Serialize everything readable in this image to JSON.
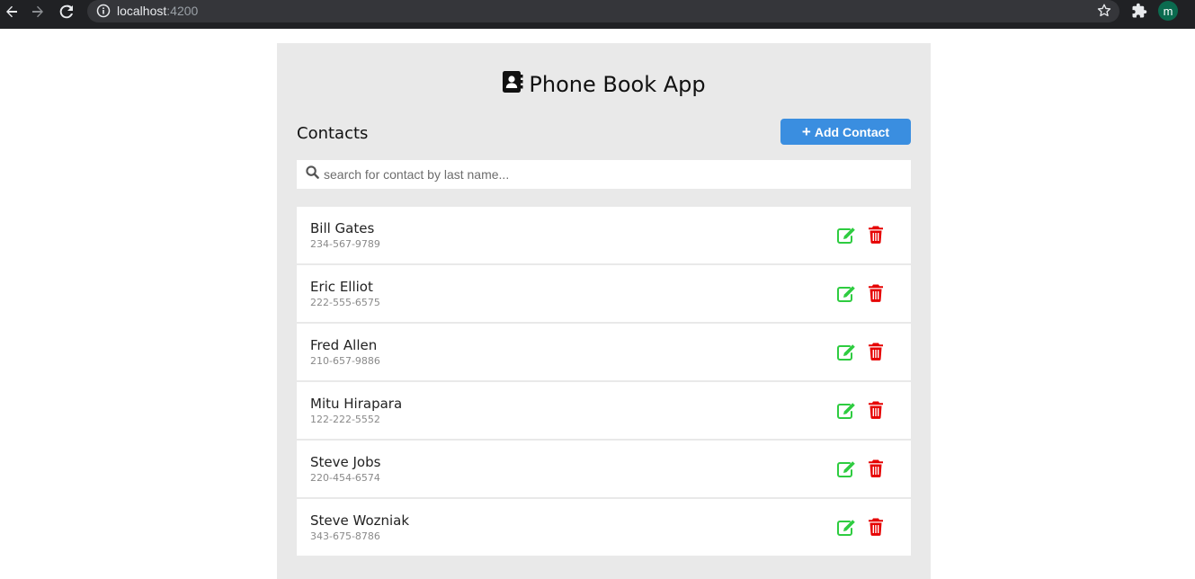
{
  "browser": {
    "url_host": "localhost",
    "url_port": ":4200",
    "profile_initial": "m"
  },
  "app": {
    "title": "Phone Book App",
    "section_label": "Contacts",
    "add_button_label": "Add Contact",
    "search_placeholder": "search for contact by last name..."
  },
  "contacts": [
    {
      "name": "Bill Gates",
      "phone": "234-567-9789"
    },
    {
      "name": "Eric Elliot",
      "phone": "222-555-6575"
    },
    {
      "name": "Fred Allen",
      "phone": "210-657-9886"
    },
    {
      "name": "Mitu Hirapara",
      "phone": "122-222-5552"
    },
    {
      "name": "Steve Jobs",
      "phone": "220-454-6574"
    },
    {
      "name": "Steve Wozniak",
      "phone": "343-675-8786"
    }
  ],
  "colors": {
    "accent": "#3a8ee0",
    "edit": "#2ecc40",
    "delete": "#e60000",
    "panel": "#e9e9e9",
    "chrome": "#202124"
  },
  "icons": [
    "back-icon",
    "forward-icon",
    "reload-icon",
    "info-icon",
    "star-icon",
    "extensions-icon",
    "contact-book-icon",
    "plus-icon",
    "search-icon",
    "edit-icon",
    "trash-icon"
  ]
}
